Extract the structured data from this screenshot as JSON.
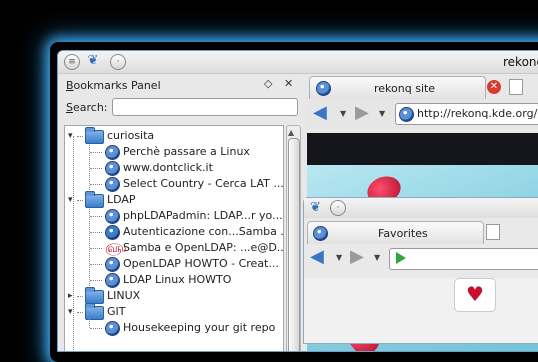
{
  "app": {
    "title": "rekonq"
  },
  "bookmarks_panel": {
    "title_prefix": "B",
    "title_rest": "ookmarks Panel",
    "search_label_prefix": "S",
    "search_label_rest": "earch:",
    "search_value": "",
    "tree": [
      {
        "type": "folder",
        "label": "curiosita",
        "expanded": true
      },
      {
        "type": "bookmark",
        "label": "Perchè passare a Linux"
      },
      {
        "type": "bookmark",
        "label": "www.dontclick.it"
      },
      {
        "type": "bookmark",
        "label": "Select Country - Cerca LAT ..."
      },
      {
        "type": "folder",
        "label": "LDAP",
        "expanded": true
      },
      {
        "type": "bookmark",
        "label": "phpLDAPadmin: LDAP...r yo..."
      },
      {
        "type": "bookmark",
        "label": "Autenticazione con...Samba ..."
      },
      {
        "type": "bookmark",
        "label": "Samba e OpenLDAP: ...e@D..."
      },
      {
        "type": "bookmark",
        "label": "OpenLDAP HOWTO - Creat..."
      },
      {
        "type": "bookmark",
        "label": "LDAP Linux HOWTO"
      },
      {
        "type": "folder",
        "label": "LINUX",
        "expanded": false
      },
      {
        "type": "folder",
        "label": "GIT",
        "expanded": true
      },
      {
        "type": "bookmark",
        "label": "Housekeeping your git repo"
      }
    ]
  },
  "browser": {
    "tab_title": "rekonq site",
    "url": "http://rekonq.kde.org/"
  },
  "favorites": {
    "tab_title": "Favorites"
  }
}
